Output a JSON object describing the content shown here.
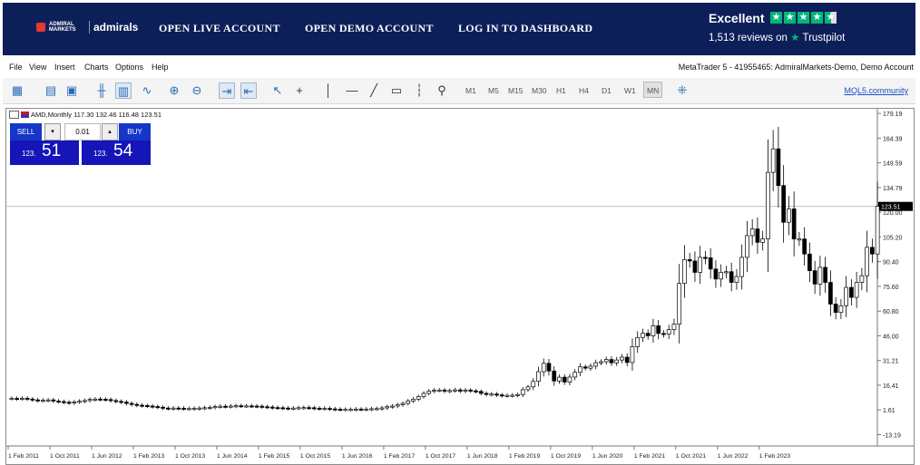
{
  "banner": {
    "logo_small": "ADMIRAL MARKETS",
    "logo_word": "admirals",
    "links": [
      "OPEN LIVE ACCOUNT",
      "OPEN DEMO ACCOUNT",
      "LOG IN TO DASHBOARD"
    ],
    "rating_word": "Excellent",
    "reviews": "1,513 reviews on",
    "trustpilot": "Trustpilot",
    "accent_color": "#00b67a"
  },
  "menu": {
    "items": [
      "File",
      "View",
      "Insert",
      "Charts",
      "Options",
      "Help"
    ],
    "window_title": "MetaTrader 5 - 41955465: AdmiralMarkets-Demo, Demo Account"
  },
  "toolbar": {
    "timeframes": [
      "M1",
      "M5",
      "M15",
      "M30",
      "H1",
      "H4",
      "D1",
      "W1",
      "MN"
    ],
    "active_timeframe": "MN",
    "community_link": "MQL5.community",
    "icons": [
      "new-chart-icon",
      "new-order-icon",
      "algo-trading-icon",
      "bar-chart-icon",
      "candlestick-chart-icon",
      "line-chart-icon",
      "zoom-in-icon",
      "zoom-out-icon",
      "autoscroll-icon",
      "chart-shift-icon",
      "cursor-icon",
      "crosshair-icon",
      "vertical-line-icon",
      "horizontal-line-icon",
      "trendline-icon",
      "text-icon",
      "fibonacci-icon",
      "shapes-icon",
      "templates-icon"
    ]
  },
  "chart": {
    "header": "AMD,Monthly  117.30 132.46 116.48 123.51",
    "trade": {
      "sell_label": "SELL",
      "buy_label": "BUY",
      "lot": "0.01",
      "sell_prefix": "123.",
      "sell_big": "51",
      "buy_prefix": "123.",
      "buy_big": "54",
      "button_color": "#1636c8"
    }
  },
  "chart_data": {
    "type": "candlestick",
    "symbol": "AMD",
    "timeframe": "Monthly",
    "last_price": 123.51,
    "ylim": [
      -20,
      182
    ],
    "y_ticks": [
      "179.19",
      "164.39",
      "149.59",
      "134.79",
      "120.00",
      "105.20",
      "90.40",
      "75.60",
      "60.80",
      "46.00",
      "31.21",
      "16.41",
      "1.61",
      "-13.19"
    ],
    "x_ticks": [
      "1 Feb 2011",
      "1 Oct 2011",
      "1 Jun 2012",
      "1 Feb 2013",
      "1 Oct 2013",
      "1 Jun 2014",
      "1 Feb 2015",
      "1 Oct 2015",
      "1 Jun 2016",
      "1 Feb 2017",
      "1 Oct 2017",
      "1 Jun 2018",
      "1 Feb 2019",
      "1 Oct 2019",
      "1 Jun 2020",
      "1 Feb 2021",
      "1 Oct 2021",
      "1 Jun 2022",
      "1 Feb 2023"
    ],
    "closes": [
      8.5,
      8.3,
      8.6,
      8.1,
      7.6,
      7.2,
      7.4,
      7.6,
      6.9,
      6.6,
      6.2,
      5.8,
      6.4,
      6.8,
      7.2,
      7.9,
      8.1,
      8.0,
      7.8,
      7.2,
      6.7,
      6.3,
      5.5,
      4.9,
      4.4,
      4.2,
      3.9,
      3.6,
      3.2,
      2.7,
      2.5,
      2.7,
      2.6,
      2.4,
      2.4,
      2.5,
      2.7,
      2.9,
      3.1,
      3.6,
      3.8,
      3.7,
      3.9,
      4.1,
      4.0,
      4.0,
      3.9,
      3.8,
      3.5,
      3.3,
      3.0,
      2.9,
      2.7,
      2.6,
      2.7,
      2.9,
      3.0,
      2.9,
      2.6,
      2.4,
      2.5,
      2.2,
      2.0,
      1.9,
      1.9,
      1.9,
      2.1,
      2.0,
      2.1,
      2.3,
      2.4,
      2.8,
      3.5,
      3.9,
      4.7,
      5.5,
      7.0,
      8.0,
      9.5,
      11.5,
      12.8,
      13.4,
      13.5,
      12.8,
      13.2,
      13.6,
      12.8,
      13.5,
      13.0,
      12.7,
      11.5,
      10.9,
      11.1,
      10.6,
      10.2,
      10.3,
      10.4,
      10.8,
      13.7,
      15.4,
      18.7,
      24.5,
      29.5,
      24.9,
      18.9,
      21.2,
      18.3,
      21.3,
      24.1,
      27.4,
      26.6,
      27.8,
      29.8,
      30.5,
      31.8,
      29.8,
      31.5,
      33.2,
      30.0,
      39.5,
      45.0,
      47.5,
      46.0,
      52.0,
      47.4,
      47.0,
      49.7,
      53.0,
      77.4,
      91.7,
      90.8,
      84.0,
      93.0,
      92.7,
      86.0,
      80.0,
      84.0,
      84.4,
      78.0,
      81.5,
      93.0,
      106.0,
      110.0,
      102.0,
      104.0,
      143.9,
      158.0,
      136.0,
      114.0,
      122.0,
      104.0,
      104.0,
      95.0,
      85.0,
      77.0,
      87.0,
      78.0,
      65.0,
      60.0,
      64.0,
      75.0,
      69.0,
      78.0,
      82.0,
      99.0,
      95.0,
      123.5
    ]
  }
}
